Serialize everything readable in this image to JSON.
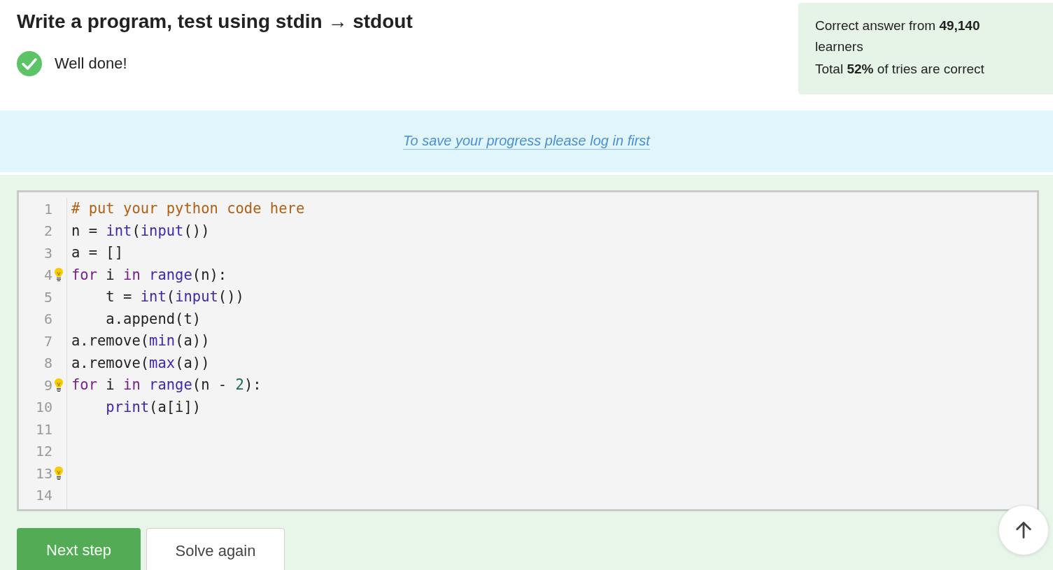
{
  "title": "Write a program, test using stdin → stdout",
  "result": {
    "passed": true,
    "message": "Well done!"
  },
  "stats": [
    "Correct answer from **49,140** learners",
    "Total **52%** of tries are correct"
  ],
  "login_notice": {
    "link": "To save your progress please log in first"
  },
  "editor": {
    "lines": [
      {
        "number": "1",
        "hint": false,
        "tokens": [
          {
            "kind": "comment",
            "text": "# put your python code here"
          }
        ]
      },
      {
        "number": "2",
        "hint": false,
        "tokens": [
          {
            "kind": "plain",
            "text": "n = "
          },
          {
            "kind": "builtin",
            "text": "int"
          },
          {
            "kind": "plain",
            "text": "("
          },
          {
            "kind": "builtin",
            "text": "input"
          },
          {
            "kind": "plain",
            "text": "())"
          }
        ]
      },
      {
        "number": "3",
        "hint": false,
        "tokens": [
          {
            "kind": "plain",
            "text": "a = []"
          }
        ]
      },
      {
        "number": "4",
        "hint": true,
        "tokens": [
          {
            "kind": "keyword",
            "text": "for"
          },
          {
            "kind": "plain",
            "text": " i "
          },
          {
            "kind": "keyword",
            "text": "in"
          },
          {
            "kind": "builtin",
            "text": " range"
          },
          {
            "kind": "plain",
            "text": "(n):"
          }
        ]
      },
      {
        "number": "5",
        "hint": false,
        "tokens": [
          {
            "kind": "plain",
            "text": "    t = "
          },
          {
            "kind": "builtin",
            "text": "int"
          },
          {
            "kind": "plain",
            "text": "("
          },
          {
            "kind": "builtin",
            "text": "input"
          },
          {
            "kind": "plain",
            "text": "())"
          }
        ]
      },
      {
        "number": "6",
        "hint": false,
        "tokens": [
          {
            "kind": "plain",
            "text": "    a.append(t)"
          }
        ]
      },
      {
        "number": "7",
        "hint": false,
        "tokens": [
          {
            "kind": "plain",
            "text": "a.remove("
          },
          {
            "kind": "builtin",
            "text": "min"
          },
          {
            "kind": "plain",
            "text": "(a))"
          }
        ]
      },
      {
        "number": "8",
        "hint": false,
        "tokens": [
          {
            "kind": "plain",
            "text": "a.remove("
          },
          {
            "kind": "builtin",
            "text": "max"
          },
          {
            "kind": "plain",
            "text": "(a))"
          }
        ]
      },
      {
        "number": "9",
        "hint": true,
        "tokens": [
          {
            "kind": "keyword",
            "text": "for"
          },
          {
            "kind": "plain",
            "text": " i "
          },
          {
            "kind": "keyword",
            "text": "in"
          },
          {
            "kind": "builtin",
            "text": " range"
          },
          {
            "kind": "plain",
            "text": "(n - "
          },
          {
            "kind": "number",
            "text": "2"
          },
          {
            "kind": "plain",
            "text": "):"
          }
        ]
      },
      {
        "number": "10",
        "hint": false,
        "tokens": [
          {
            "kind": "builtin",
            "text": "    print"
          },
          {
            "kind": "plain",
            "text": "(a[i])"
          }
        ]
      },
      {
        "number": "11",
        "hint": false
      },
      {
        "number": "12",
        "hint": false
      },
      {
        "number": "13",
        "hint": true
      },
      {
        "number": "14",
        "hint": false
      }
    ]
  },
  "buttons": [
    {
      "label": "Next step",
      "kind": "primary"
    },
    {
      "label": "Solve again",
      "kind": "secondary"
    }
  ]
}
